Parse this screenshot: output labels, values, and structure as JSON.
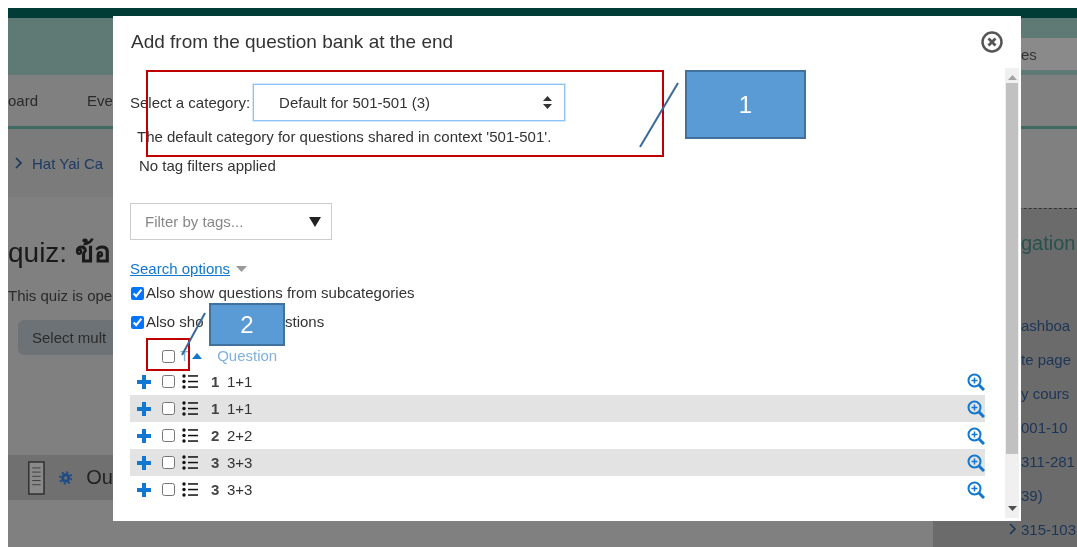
{
  "page_background": {
    "nav_items": [
      "oard",
      "Eve"
    ],
    "breadcrumb": "Hat Yai Ca",
    "heading": "quiz: **ข้อ**",
    "notice": "This quiz is ope",
    "button": "Select mult",
    "section_title": "Ou",
    "search_text": "es",
    "block_title": "gation",
    "block_items": [
      {
        "label": "ashboa"
      },
      {
        "label": "te page"
      },
      {
        "label": "y cours"
      },
      {
        "label": "001-10"
      },
      {
        "label": "311-281"
      },
      {
        "label": "39)"
      },
      {
        "label": "315-103"
      }
    ]
  },
  "dialog": {
    "title": "Add from the question bank at the end",
    "category_label": "Select a category:",
    "category_value": "Default for 501-501 (3)",
    "category_description": "The default category for questions shared in context '501-501'.",
    "tag_filter_status": "No tag filters applied",
    "tag_filter": {
      "placeholder": "Filter by tags..."
    },
    "search_options_link": "Search options",
    "options": [
      {
        "label": "Also show questions from subcategories",
        "checked": true
      },
      {
        "label": "Also sho",
        "label_tail": "stions",
        "checked": true
      }
    ],
    "table": {
      "select_all_checked": false,
      "columns": [
        {
          "label": "T",
          "sorted": true
        },
        {
          "label": "Question",
          "sorted": false
        }
      ],
      "rows": [
        {
          "type": "1",
          "name": "1+1",
          "checked": false
        },
        {
          "type": "1",
          "name": "1+1",
          "checked": false
        },
        {
          "type": "2",
          "name": "2+2",
          "checked": false
        },
        {
          "type": "3",
          "name": "3+3",
          "checked": false
        },
        {
          "type": "3",
          "name": "3+3",
          "checked": false
        }
      ]
    }
  },
  "annotations": [
    {
      "label": "1"
    },
    {
      "label": "2"
    }
  ]
}
